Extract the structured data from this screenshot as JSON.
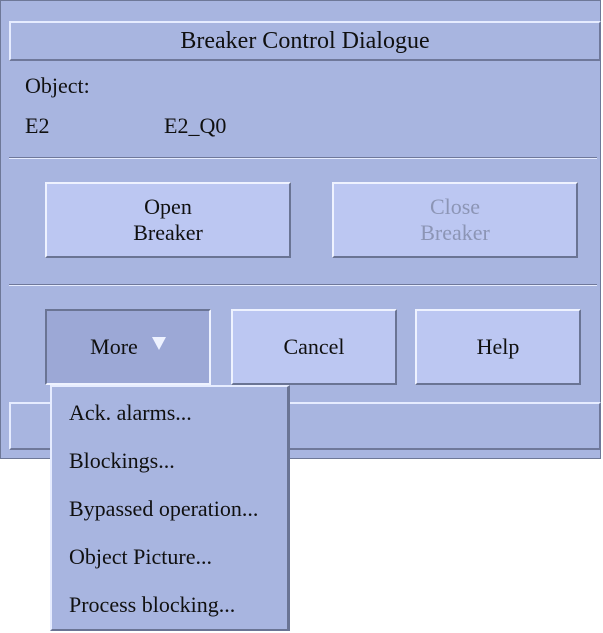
{
  "dialog": {
    "title": "Breaker Control Dialogue",
    "object_label": "Object:",
    "object_station": "E2",
    "object_name": "E2_Q0"
  },
  "buttons": {
    "open_line1": "Open",
    "open_line2": "Breaker",
    "close_line1": "Close",
    "close_line2": "Breaker",
    "close_enabled": false,
    "more": "More",
    "cancel": "Cancel",
    "help": "Help"
  },
  "more_menu": {
    "items": [
      {
        "label": "Ack. alarms..."
      },
      {
        "label": "Blockings..."
      },
      {
        "label": "Bypassed operation..."
      },
      {
        "label": "Object Picture..."
      },
      {
        "label": "Process blocking..."
      }
    ]
  },
  "colors": {
    "background": "#a8b5e0",
    "button": "#bcc7f2",
    "disabled_text": "#8c95b5"
  }
}
